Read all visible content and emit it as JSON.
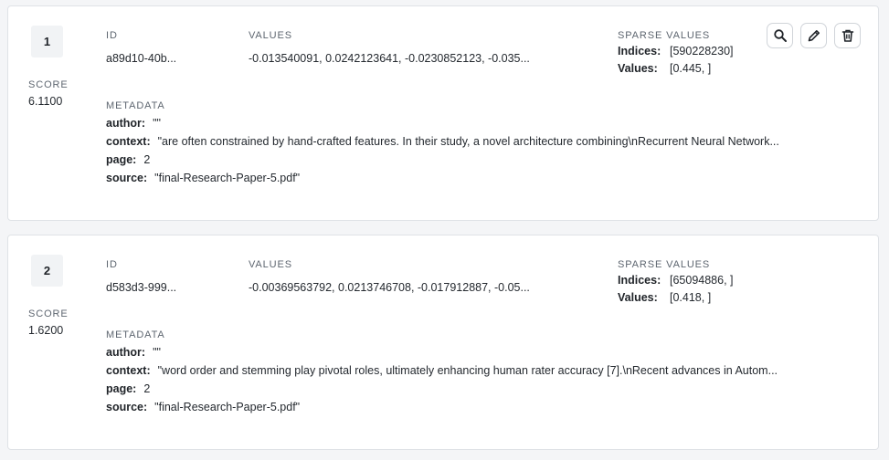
{
  "labels": {
    "score": "SCORE",
    "id": "ID",
    "values": "VALUES",
    "sparse_values": "SPARSE VALUES",
    "metadata": "METADATA",
    "indices_key": "Indices:",
    "values_key": "Values:",
    "author_key": "author:",
    "context_key": "context:",
    "page_key": "page:",
    "source_key": "source:"
  },
  "records": [
    {
      "rank": "1",
      "score": "6.1100",
      "id": "a89d10-40b...",
      "values": "-0.013540091, 0.0242123641, -0.0230852123, -0.035...",
      "sparse_indices": "[59022823​0]",
      "sparse_values": "[0.445,        ]",
      "author": "\"\"",
      "context": "\"are often constrained by hand-crafted features. In their study, a novel architecture combining\\nRecurrent Neural Network...",
      "page": "2",
      "source": "\"final-Research-Paper-5.pdf\""
    },
    {
      "rank": "2",
      "score": "1.6200",
      "id": "d583d3-999...",
      "values": "-0.00369563792, 0.0213746708, -0.017912887, -0.05...",
      "sparse_indices": "[65094886, ]",
      "sparse_values": "[0.418,        ]",
      "author": "\"\"",
      "context": "\"word order and stemming play pivotal roles, ultimately enhancing human rater accuracy [7].\\nRecent advances in Autom...",
      "page": "2",
      "source": "\"final-Research-Paper-5.pdf\""
    }
  ],
  "icons": {
    "search": "search-icon",
    "edit": "pencil-icon",
    "delete": "trash-icon"
  }
}
